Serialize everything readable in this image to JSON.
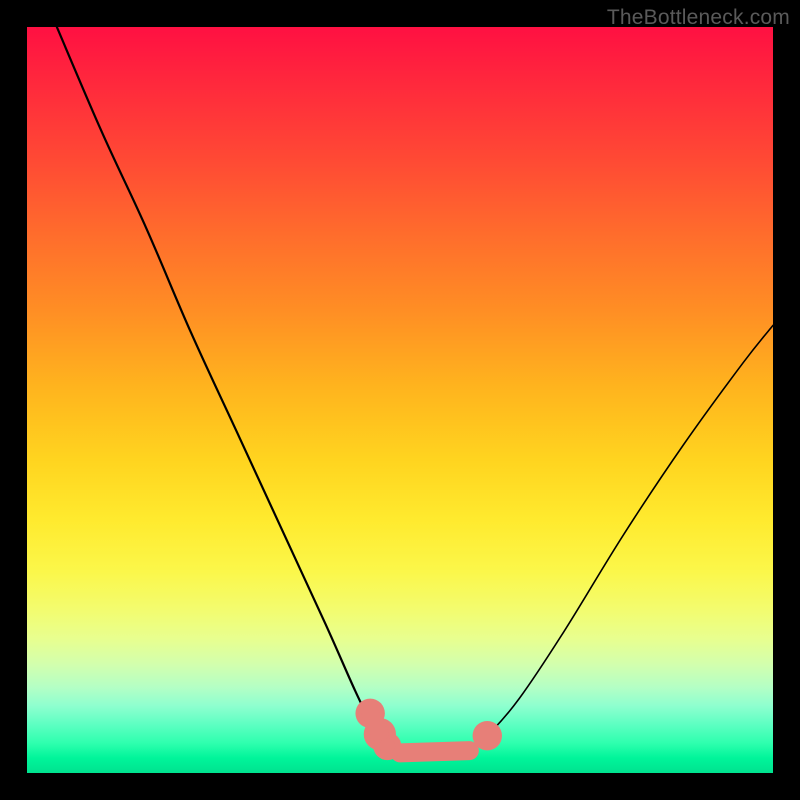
{
  "watermark": "TheBottleneck.com",
  "colors": {
    "frame": "#000000",
    "curve": "#000000",
    "marker": "#e77f78"
  },
  "chart_data": {
    "type": "line",
    "title": "",
    "xlabel": "",
    "ylabel": "",
    "xlim": [
      0,
      100
    ],
    "ylim": [
      0,
      100
    ],
    "grid": false,
    "note": "Qualitative bottleneck curve; axes unlabeled in source. x is component balance position (approx 0–100 left→right), y is bottleneck severity (0 = green/good at bottom, 100 = red/bad at top). Values estimated from pixel positions.",
    "series": [
      {
        "name": "left-arm",
        "x": [
          4,
          10,
          16,
          22,
          28,
          34,
          40,
          44,
          46,
          47.5,
          49,
          51,
          54
        ],
        "y": [
          100,
          86,
          73,
          59,
          46,
          33,
          20,
          11,
          7,
          5,
          3.3,
          2.4,
          2
        ]
      },
      {
        "name": "right-arm",
        "x": [
          54,
          58,
          60,
          62,
          66,
          72,
          80,
          88,
          96,
          100
        ],
        "y": [
          2,
          2.6,
          3.6,
          5.3,
          10,
          19,
          32,
          44,
          55,
          60
        ]
      }
    ],
    "markers": {
      "name": "highlight-points",
      "note": "Salmon dots/pills near the trough of the curve",
      "points": [
        {
          "x": 46.0,
          "y": 8.0,
          "r": 1.3
        },
        {
          "x": 47.3,
          "y": 5.2,
          "r": 1.5
        },
        {
          "x": 48.3,
          "y": 3.6,
          "r": 1.2
        },
        {
          "x": 50.0,
          "y": 2.7,
          "r": 1.1
        },
        {
          "x": 52.0,
          "y": 2.2,
          "r": 1.1
        },
        {
          "x": 54.0,
          "y": 2.0,
          "r": 1.1
        },
        {
          "x": 56.0,
          "y": 2.1,
          "r": 1.1
        },
        {
          "x": 58.0,
          "y": 2.4,
          "r": 1.1
        },
        {
          "x": 59.3,
          "y": 3.0,
          "r": 1.1
        },
        {
          "x": 61.7,
          "y": 5.0,
          "r": 1.3
        }
      ]
    }
  }
}
